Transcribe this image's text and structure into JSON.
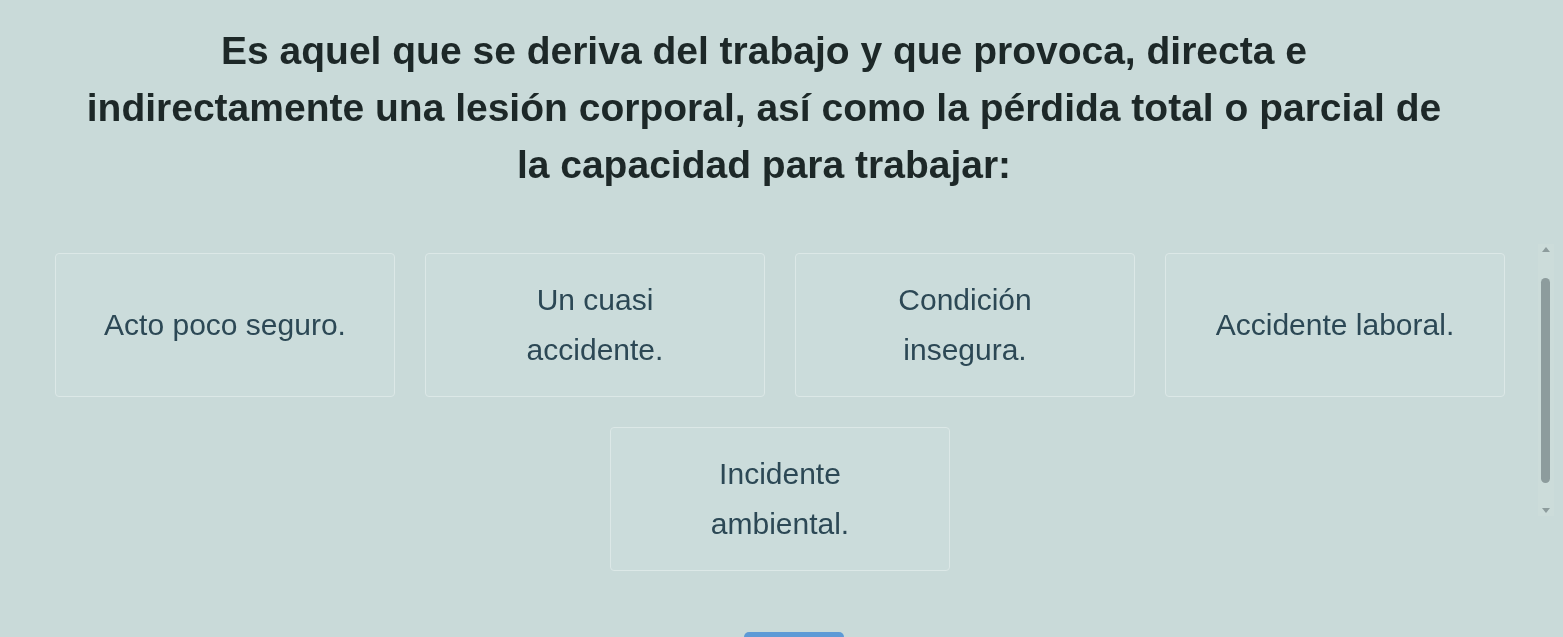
{
  "question": {
    "lines": [
      "Es aquel que se deriva del trabajo y que provoca, directa e",
      "indirectamente una lesión corporal, así como la pérdida total o parcial de",
      "la capacidad para trabajar:"
    ]
  },
  "options": [
    {
      "label": "Acto poco seguro."
    },
    {
      "label": "Un cuasi accidente."
    },
    {
      "label": "Condición insegura."
    },
    {
      "label": "Accidente laboral."
    },
    {
      "label": "Incidente ambiental."
    }
  ]
}
